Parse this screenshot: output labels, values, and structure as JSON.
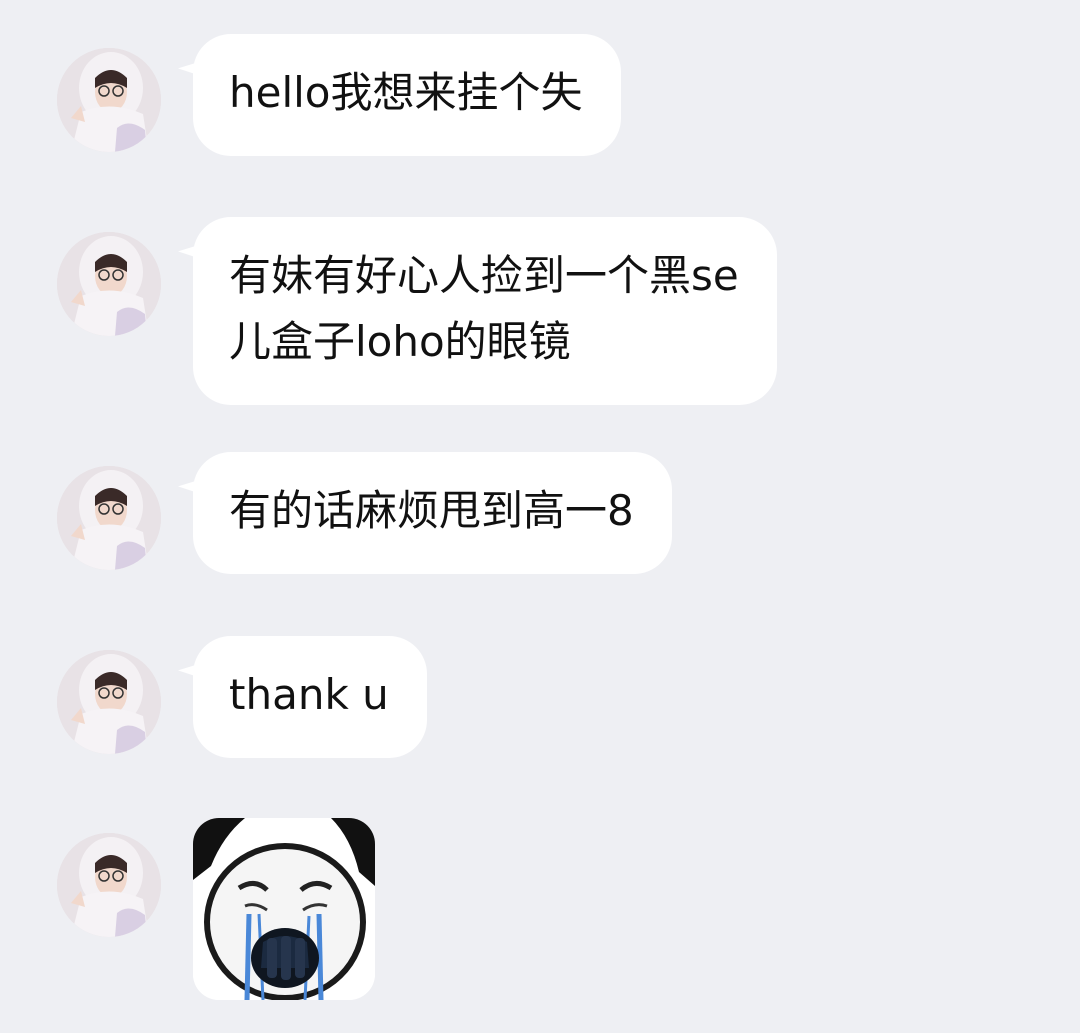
{
  "chat": {
    "messages": [
      {
        "type": "text",
        "lines": [
          "hello我想来挂个失"
        ]
      },
      {
        "type": "text",
        "lines": [
          "有妹有好心人捡到一个黑se",
          "儿盒子loho的眼镜"
        ]
      },
      {
        "type": "text",
        "lines": [
          "有的话麻烦甩到高一8"
        ]
      },
      {
        "type": "text",
        "lines": [
          "thank u"
        ]
      },
      {
        "type": "sticker",
        "sticker": "crying-panda-meme"
      }
    ]
  },
  "colors": {
    "background": "#eeeff3",
    "bubble": "#ffffff",
    "text": "#111111"
  },
  "icons": {
    "avatar": "girl-in-white-hood-avatar",
    "sticker": "crying-panda-face-sticker"
  }
}
